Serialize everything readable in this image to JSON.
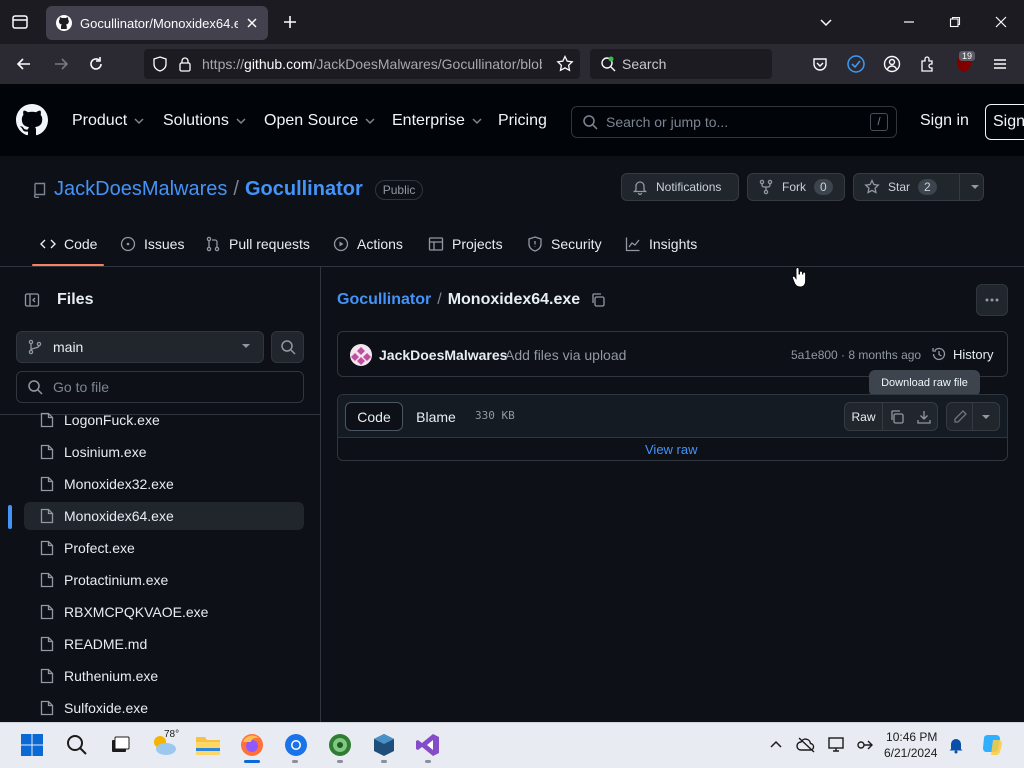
{
  "browser": {
    "tab_title": "Gocullinator/Monoxidex64.exe",
    "url_prefix": "https://",
    "url_host": "github.com",
    "url_path": "/JackDoesMalwares/Gocullinator/blob/",
    "search_placeholder": "Search",
    "extension_badge": "19"
  },
  "github_header": {
    "nav": [
      "Product",
      "Solutions",
      "Open Source",
      "Enterprise",
      "Pricing"
    ],
    "search_placeholder": "Search or jump to...",
    "search_shortcut": "/",
    "signin": "Sign in",
    "signup": "Sign"
  },
  "repo": {
    "owner": "JackDoesMalwares",
    "separator": "/",
    "name": "Gocullinator",
    "visibility": "Public",
    "notifications_label": "Notifications",
    "fork_label": "Fork",
    "fork_count": "0",
    "star_label": "Star",
    "star_count": "2",
    "tabs": [
      "Code",
      "Issues",
      "Pull requests",
      "Actions",
      "Projects",
      "Security",
      "Insights"
    ]
  },
  "sidebar": {
    "heading": "Files",
    "branch": "main",
    "goto_placeholder": "Go to file",
    "files": [
      "LogonFuck.exe",
      "Losinium.exe",
      "Monoxidex32.exe",
      "Monoxidex64.exe",
      "Profect.exe",
      "Protactinium.exe",
      "RBXMCPQKVAOE.exe",
      "README.md",
      "Ruthenium.exe",
      "Sulfoxide.exe"
    ],
    "selected_index": 3
  },
  "file_view": {
    "breadcrumb_repo": "Gocullinator",
    "breadcrumb_sep": "/",
    "breadcrumb_file": "Monoxidex64.exe",
    "commit_author": "JackDoesMalwares",
    "commit_message": "Add files via upload",
    "commit_meta": "5a1e800 · 8 months ago",
    "history_label": "History",
    "tooltip": "Download raw file",
    "seg_code": "Code",
    "seg_blame": "Blame",
    "file_size": "330 KB",
    "raw_label": "Raw",
    "view_raw": "View raw"
  },
  "taskbar": {
    "weather_temp": "78°",
    "time": "10:46 PM",
    "date": "6/21/2024"
  },
  "colors": {
    "accent_link": "#4493f8",
    "tab_underline": "#f78166",
    "bg": "#0d1117"
  }
}
